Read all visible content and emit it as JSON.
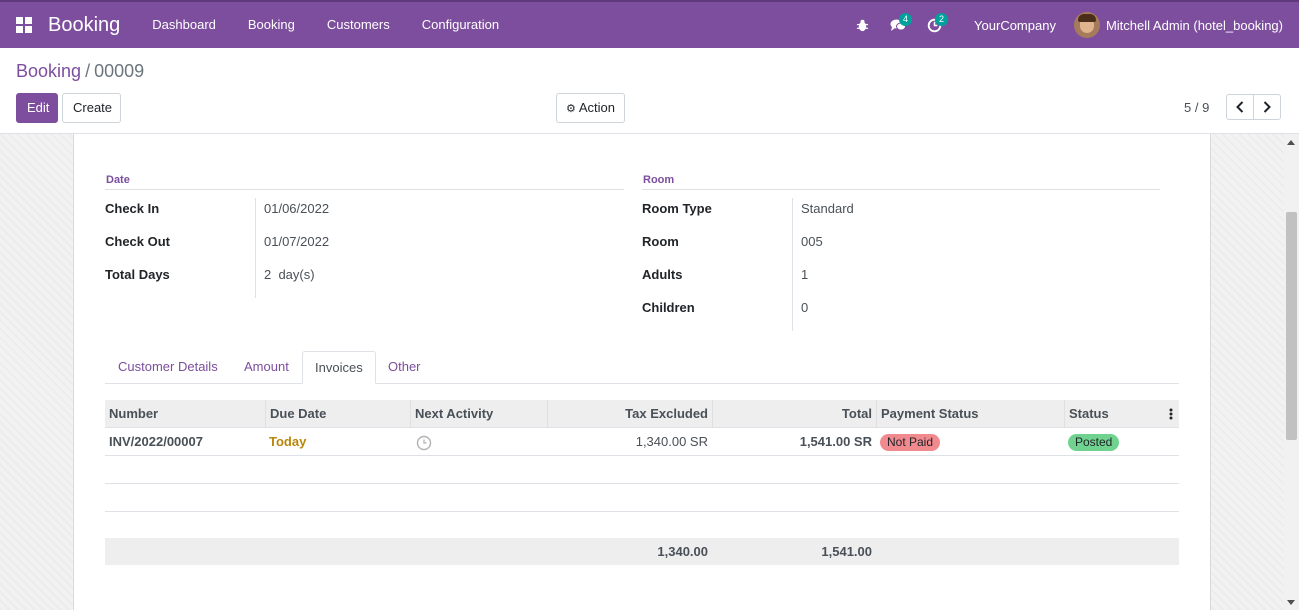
{
  "navbar": {
    "brand": "Booking",
    "menu": [
      "Dashboard",
      "Booking",
      "Customers",
      "Configuration"
    ],
    "messages_count": "4",
    "activities_count": "2",
    "company": "YourCompany",
    "user": "Mitchell Admin (hotel_booking)"
  },
  "breadcrumb": {
    "parent": "Booking",
    "separator": "/",
    "current": "00009"
  },
  "buttons": {
    "edit": "Edit",
    "create": "Create",
    "action": "Action"
  },
  "pager": {
    "value": "5 / 9"
  },
  "date_group": {
    "title": "Date",
    "fields": [
      {
        "label": "Check In",
        "value": "01/06/2022"
      },
      {
        "label": "Check Out",
        "value": "01/07/2022"
      },
      {
        "label": "Total Days",
        "value": "2  day(s)"
      }
    ]
  },
  "room_group": {
    "title": "Room",
    "fields": [
      {
        "label": "Room Type",
        "value": "Standard"
      },
      {
        "label": "Room",
        "value": "005"
      },
      {
        "label": "Adults",
        "value": "1"
      },
      {
        "label": "Children",
        "value": "0"
      }
    ]
  },
  "tabs": [
    "Customer Details",
    "Amount",
    "Invoices",
    "Other"
  ],
  "active_tab": "Invoices",
  "invoice_table": {
    "columns": [
      "Number",
      "Due Date",
      "Next Activity",
      "Tax Excluded",
      "Total",
      "Payment Status",
      "Status"
    ],
    "rows": [
      {
        "number": "INV/2022/00007",
        "due_date": "Today",
        "tax_excluded": "1,340.00 SR",
        "total": "1,541.00 SR",
        "payment_status": "Not Paid",
        "status": "Posted"
      }
    ],
    "totals": {
      "tax_excluded": "1,340.00",
      "total": "1,541.00"
    }
  },
  "colors": {
    "primary": "#7c4e9d",
    "due_today": "#b8860b",
    "not_paid": "#f08a8f",
    "posted": "#6fd38f"
  }
}
